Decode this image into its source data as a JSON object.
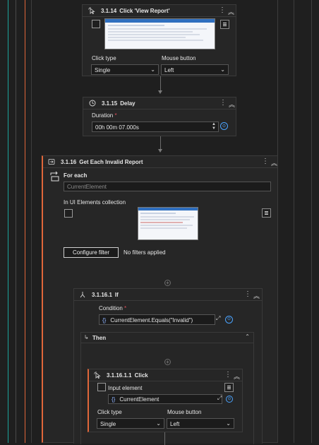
{
  "steps": {
    "s14": {
      "number": "3.1.14",
      "title": "Click 'View Report'",
      "click_type_label": "Click type",
      "click_type_value": "Single",
      "mouse_button_label": "Mouse button",
      "mouse_button_value": "Left"
    },
    "s15": {
      "number": "3.1.15",
      "title": "Delay",
      "duration_label": "Duration",
      "required_mark": "*",
      "duration_value": "00h 00m 07.000s"
    },
    "s16": {
      "number": "3.1.16",
      "title": "Get Each Invalid Report",
      "for_each_label": "For each",
      "current_element_placeholder": "CurrentElement",
      "collection_label": "In UI Elements collection",
      "configure_filter_label": "Configure filter",
      "filters_status": "No filters applied"
    },
    "s161": {
      "number": "3.1.16.1",
      "title": "If",
      "condition_label": "Condition",
      "required_mark": "*",
      "condition_value": "CurrentElement.Equals(\"Invalid\")",
      "then_label": "Then"
    },
    "s1611": {
      "number": "3.1.16.1.1",
      "title": "Click",
      "input_element_label": "Input element",
      "input_element_value": "CurrentElement",
      "click_type_label": "Click type",
      "click_type_value": "Single",
      "mouse_button_label": "Mouse button",
      "mouse_button_value": "Left"
    }
  },
  "icons": {
    "more": "more-dots-icon",
    "collapse": "collapse-chevrons-icon",
    "click": "mouse-click-icon",
    "delay": "clock-icon",
    "foreach": "loop-icon",
    "if": "branch-icon",
    "menu": "hamburger-icon",
    "variable": "braces-icon",
    "add": "plus-circle-icon"
  },
  "colors": {
    "teal_rail": "#1ba39c",
    "orange_rail": "#e0663a",
    "accent_orange": "#e0663a",
    "blue_link": "#4aa3ff"
  }
}
